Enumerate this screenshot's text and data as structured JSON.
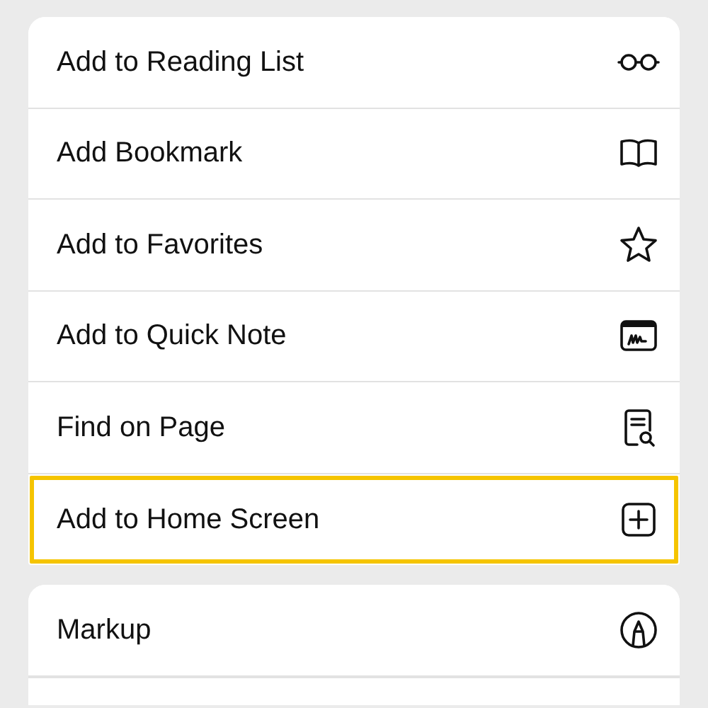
{
  "groups": [
    {
      "items": [
        {
          "label": "Add to Reading List",
          "kind": "glasses",
          "highlighted": false
        },
        {
          "label": "Add Bookmark",
          "kind": "book",
          "highlighted": false
        },
        {
          "label": "Add to Favorites",
          "kind": "star",
          "highlighted": false
        },
        {
          "label": "Add to Quick Note",
          "kind": "note",
          "highlighted": false
        },
        {
          "label": "Find on Page",
          "kind": "docsearch",
          "highlighted": false
        },
        {
          "label": "Add to Home Screen",
          "kind": "plussquare",
          "highlighted": true
        }
      ]
    },
    {
      "items": [
        {
          "label": "Markup",
          "kind": "markup",
          "highlighted": false
        }
      ]
    }
  ]
}
